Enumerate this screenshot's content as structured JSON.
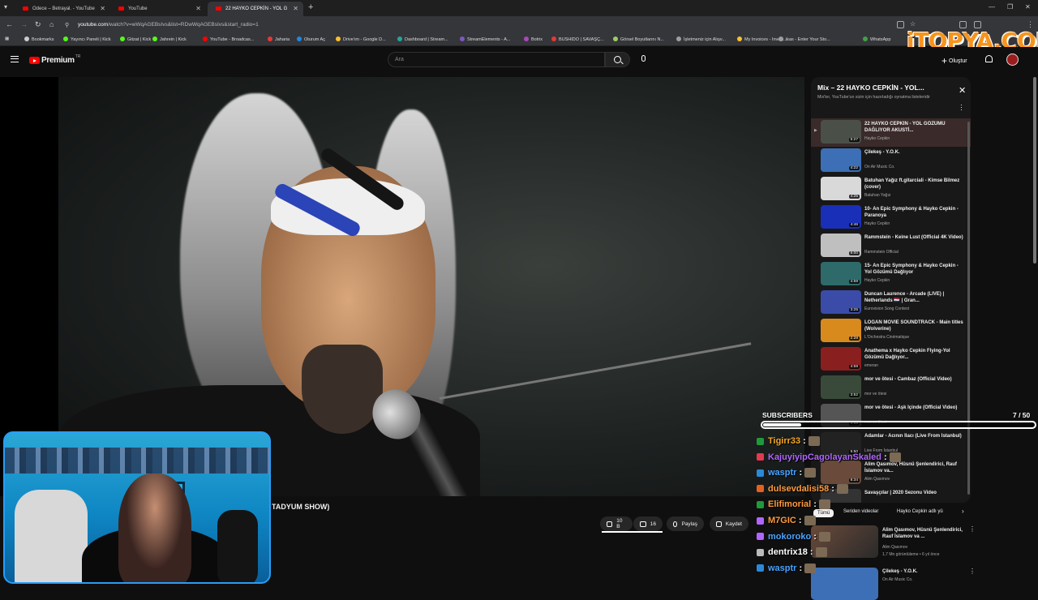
{
  "browser": {
    "tabs": [
      {
        "title": "Odece – Betrayal. - YouTube",
        "active": false
      },
      {
        "title": "YouTube",
        "active": false
      },
      {
        "title": "22 HAYKO CEPKİN - YOL G",
        "active": true
      }
    ],
    "url_host": "youtube.com",
    "url_path": "/watch?v=wWqAGEBsIvs&list=RDwWqAGEBsIvs&start_radio=1",
    "bookmarks": [
      {
        "label": "Bookmarks",
        "color": "#cccccc"
      },
      {
        "label": "Yayıncı Paneli | Kick",
        "color": "#53fc18"
      },
      {
        "label": "Gitzat | Kick",
        "color": "#53fc18"
      },
      {
        "label": "Jahrein | Kick",
        "color": "#53fc18"
      },
      {
        "label": "YouTube - Broadcas...",
        "color": "#ff0000"
      },
      {
        "label": "Jaharia",
        "color": "#e53935"
      },
      {
        "label": "Oturum Aç",
        "color": "#1e88e5"
      },
      {
        "label": "Drive'ım - Google D...",
        "color": "#fbc02d"
      },
      {
        "label": "Dashboard | Stream...",
        "color": "#26a69a"
      },
      {
        "label": "StreamElements - A...",
        "color": "#7e57c2"
      },
      {
        "label": "Botrix",
        "color": "#ab47bc"
      },
      {
        "label": "BUSHIDO | SAVAŞÇ...",
        "color": "#e53935"
      },
      {
        "label": "Görsel Boyutlarını N...",
        "color": "#9ccc65"
      },
      {
        "label": "İşletmeniz için Alışv...",
        "color": "#9e9e9e"
      },
      {
        "label": "My Invoices - Invoic...",
        "color": "#fbc02d"
      },
      {
        "label": "ikas - Enter Your Sto...",
        "color": "#9e9e9e"
      },
      {
        "label": "WhatsApp",
        "color": "#43a047"
      }
    ],
    "brand_overlay": "iTOPYA.COM"
  },
  "header": {
    "logo": "Premium",
    "region": "TR",
    "search_placeholder": "Ara",
    "create_label": "Oluştur"
  },
  "video": {
    "title_fragment": "TADYUM SHOW)",
    "like_count": "10 B",
    "dislike_count": "16",
    "share_label": "Paylaş",
    "save_label": "Kaydet"
  },
  "playlist": {
    "title": "Mix – 22 HAYKO CEPKİN - YOL...",
    "subtitle": "Mix'ler, YouTube'un sizin için hazırladığı oynatma listeleridir",
    "items": [
      {
        "title": "22 HAYKO CEPKİN - YOL GÖZÜMÜ DAĞLIYOR AKUSTİ...",
        "channel": "Hayko Cepkin",
        "duration": "5:27",
        "active": true,
        "thumb": "#4a5048"
      },
      {
        "title": "Çilekeş - Y.O.K.",
        "channel": "On Air Music Co.",
        "duration": "4:22",
        "active": false,
        "thumb": "#3c6fb5"
      },
      {
        "title": "Batuhan Yağız ft.gitarciali - Kimse Bilmez (cover)",
        "channel": "Batuhan Yağız",
        "duration": "4:25",
        "active": false,
        "thumb": "#d9d9d9"
      },
      {
        "title": "10- An Epic Symphony & Hayko Cepkin - Paranoya",
        "channel": "Hayko Cepkin",
        "duration": "4:46",
        "active": false,
        "thumb": "#1a2fb8"
      },
      {
        "title": "Rammstein - Keine Lust (Official 4K Video)",
        "channel": "Rammstein Official",
        "duration": "6:00",
        "active": false,
        "thumb": "#bfbfbf"
      },
      {
        "title": "15- An Epic Symphony & Hayko Cepkin - Yol Gözümü Dağlıyor",
        "channel": "Hayko Cepkin",
        "duration": "4:59",
        "active": false,
        "thumb": "#2f6a6a"
      },
      {
        "title": "Duncan Laurence - Arcade (LIVE) | Netherlands 🇳🇱 | Gran...",
        "channel": "Eurovision Song Contest",
        "duration": "3:25",
        "active": false,
        "thumb": "#3a4ca8"
      },
      {
        "title": "LOGAN MOVIE SOUNDTRACK - Main titles (Wolverine)",
        "channel": "L'Orchestra Cinématique",
        "duration": "2:28",
        "active": false,
        "thumb": "#d98a1c"
      },
      {
        "title": "Anathema x Hayko Cepkin Flying-Yol Gözümü Dağlıyor...",
        "channel": "emeran",
        "duration": "4:59",
        "active": false,
        "thumb": "#8a1f1f"
      },
      {
        "title": "mor ve ötesi - Cambaz (Official Video)",
        "channel": "mor ve ötesi",
        "duration": "3:52",
        "active": false,
        "thumb": "#3a4a3a"
      },
      {
        "title": "mor ve ötesi - Aşk İçinde (Official Video)",
        "channel": "mor ve ötesi",
        "duration": "3:59",
        "active": false,
        "thumb": "#555555"
      },
      {
        "title": "Adamlar - Acının İlacı (Live From İstanbul)",
        "channel": "Live From İstanbul",
        "duration": "5:50",
        "active": false,
        "thumb": "#222222"
      },
      {
        "title": "Alim Qasımov, Hüsnü Şenlendirici, Rauf İslamov va...",
        "channel": "Alim Qasımov",
        "duration": "8:34",
        "active": false,
        "thumb": "#6a4a3a"
      },
      {
        "title": "Savaşçılar | 2020 Sezonu Video",
        "channel": "",
        "duration": "",
        "active": false,
        "thumb": "#333333"
      }
    ]
  },
  "subscribers": {
    "label": "SUBSCRIBERS",
    "count": "7 / 50",
    "progress": 0.14
  },
  "chat": [
    {
      "user": "Tigirr33",
      "color": "#f5a623",
      "badge": "#1e9a3a"
    },
    {
      "user": "KajuyiyipCagolayanSkaled",
      "color": "#b066ff",
      "badge": "#e53950"
    },
    {
      "user": "wasptr",
      "color": "#4aa3ff",
      "badge": "#2a8ad8"
    },
    {
      "user": "dulsevdalisi58",
      "color": "#ff9a3c",
      "badge": "#e56020"
    },
    {
      "user": "Elifimorial",
      "color": "#ff9a3c",
      "badge": "#1e9a3a"
    },
    {
      "user": "M7GIC",
      "color": "#ff9a3c",
      "badge": "#b066ff"
    },
    {
      "user": "mokoroko",
      "color": "#4aa3ff",
      "badge": "#b066ff"
    },
    {
      "user": "dentrix18",
      "color": "#ffffff",
      "badge": "#bbbbbb"
    },
    {
      "user": "wasptr",
      "color": "#4aa3ff",
      "badge": "#2a8ad8"
    }
  ],
  "chips": {
    "all": "Tümü",
    "series": "Seriden videolar",
    "hayko": "Hayko Cepkin adlı yü"
  },
  "recs": [
    {
      "title": "Alim Qasımov, Hüsnü Şenlendirici, Rauf İslamov va ...",
      "channel": "Alim Qasımov",
      "meta": "1,7 Mn görüntüleme • 6 yıl önce",
      "duration": "8:34"
    },
    {
      "title": "Çilekeş - Y.O.K.",
      "channel": "On Air Music Co.",
      "meta": "",
      "duration": ""
    }
  ]
}
